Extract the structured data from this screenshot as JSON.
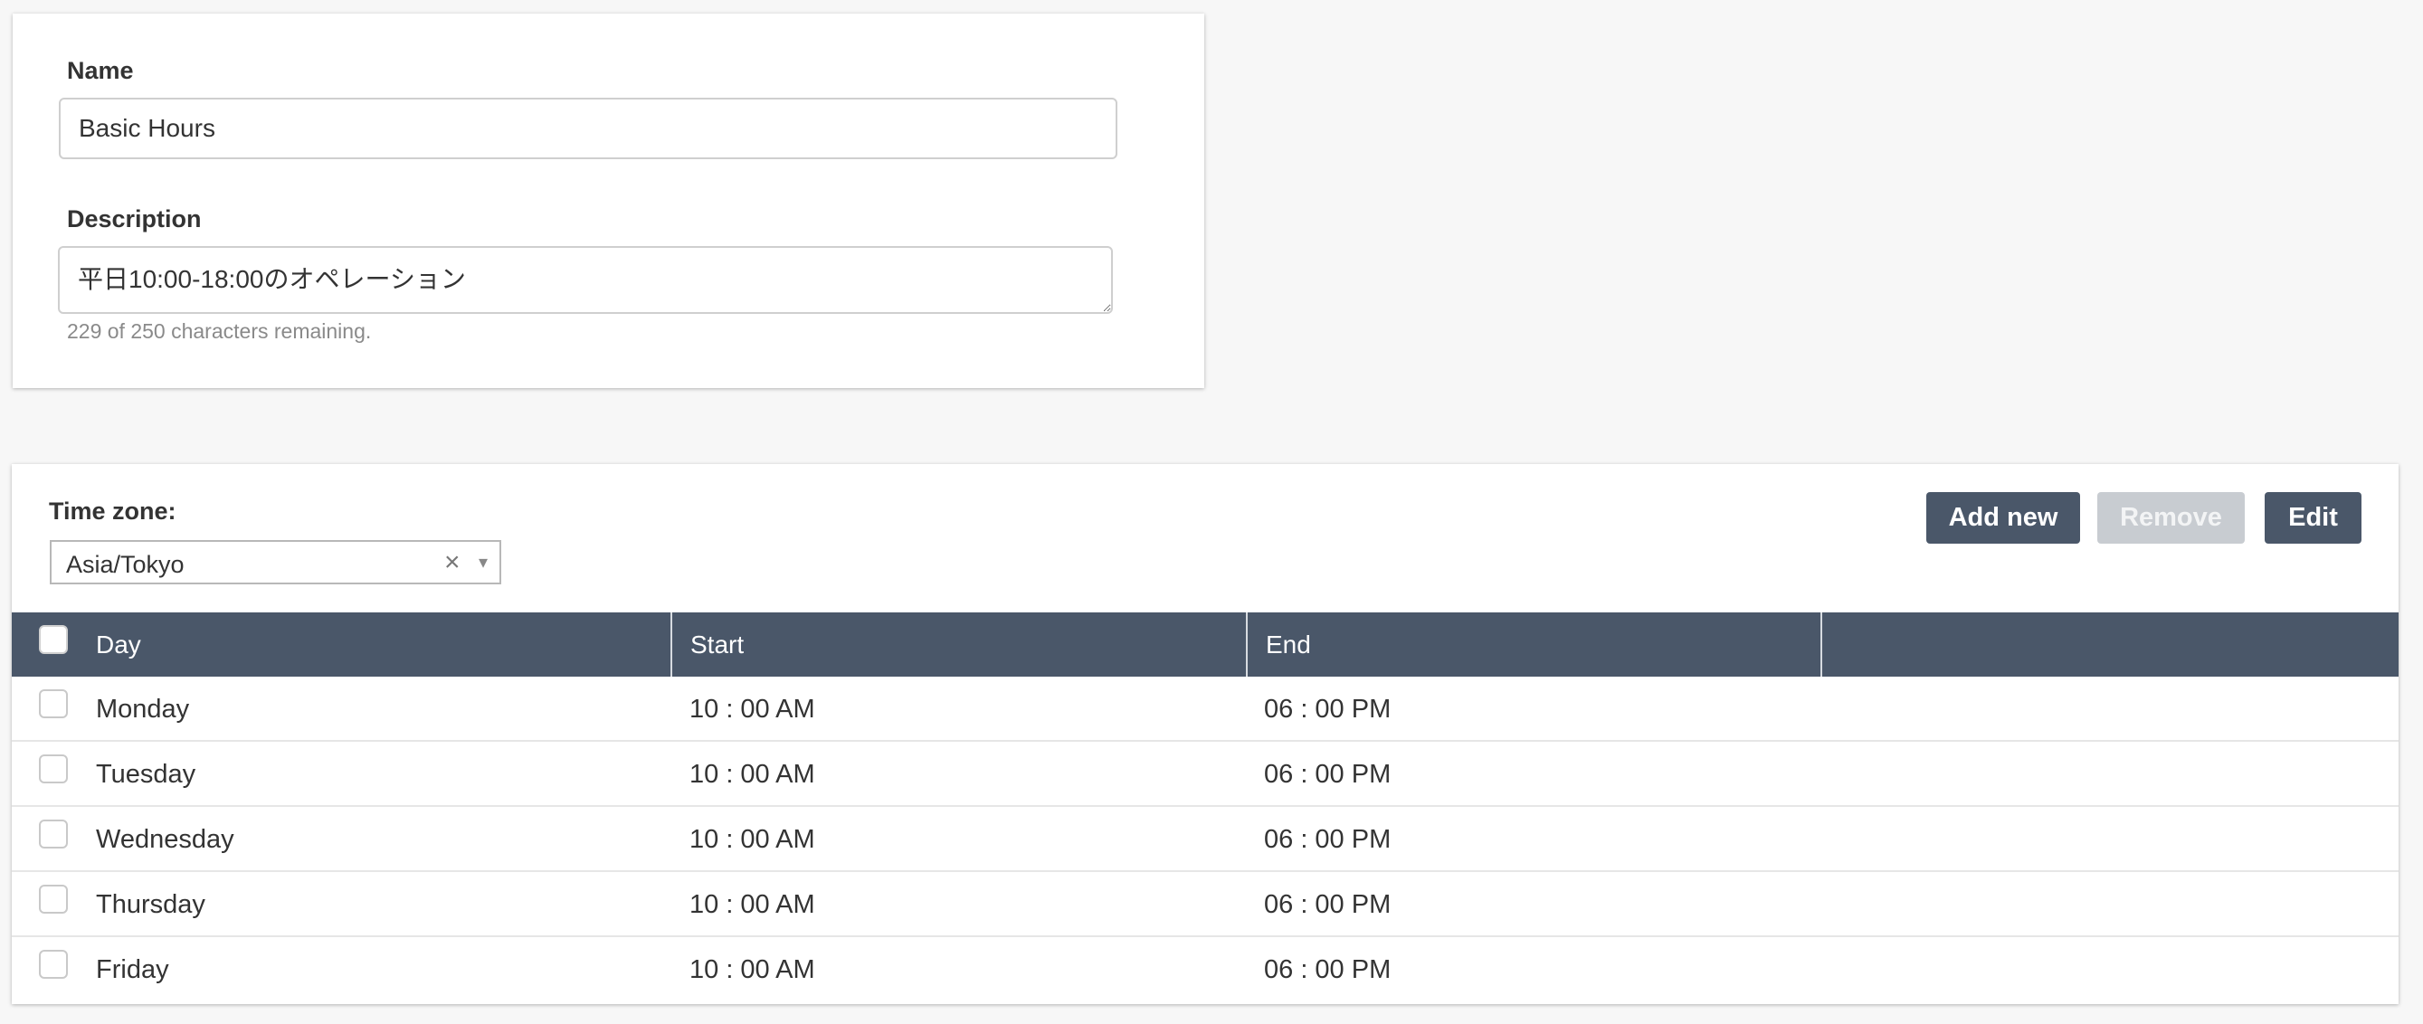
{
  "details": {
    "name_label": "Name",
    "name_value": "Basic Hours",
    "description_label": "Description",
    "description_value": "平日10:00-18:00のオペレーション",
    "char_hint": "229 of 250 characters remaining."
  },
  "schedule": {
    "timezone_label": "Time zone:",
    "timezone_value": "Asia/Tokyo",
    "clear_glyph": "×",
    "caret_glyph": "▾",
    "buttons": {
      "add": "Add new",
      "remove": "Remove",
      "edit": "Edit"
    },
    "remove_disabled": true,
    "columns": {
      "day": "Day",
      "start": "Start",
      "end": "End",
      "extra": ""
    },
    "rows": [
      {
        "day": "Monday",
        "start": "10 : 00 AM",
        "end": "06 : 00 PM",
        "checked": false
      },
      {
        "day": "Tuesday",
        "start": "10 : 00 AM",
        "end": "06 : 00 PM",
        "checked": false
      },
      {
        "day": "Wednesday",
        "start": "10 : 00 AM",
        "end": "06 : 00 PM",
        "checked": false
      },
      {
        "day": "Thursday",
        "start": "10 : 00 AM",
        "end": "06 : 00 PM",
        "checked": false
      },
      {
        "day": "Friday",
        "start": "10 : 00 AM",
        "end": "06 : 00 PM",
        "checked": false
      }
    ]
  },
  "colors": {
    "header_bg": "#4a5769",
    "button_primary": "#4a5769",
    "button_disabled": "#c8ccd1",
    "page_bg": "#f7f7f7"
  }
}
